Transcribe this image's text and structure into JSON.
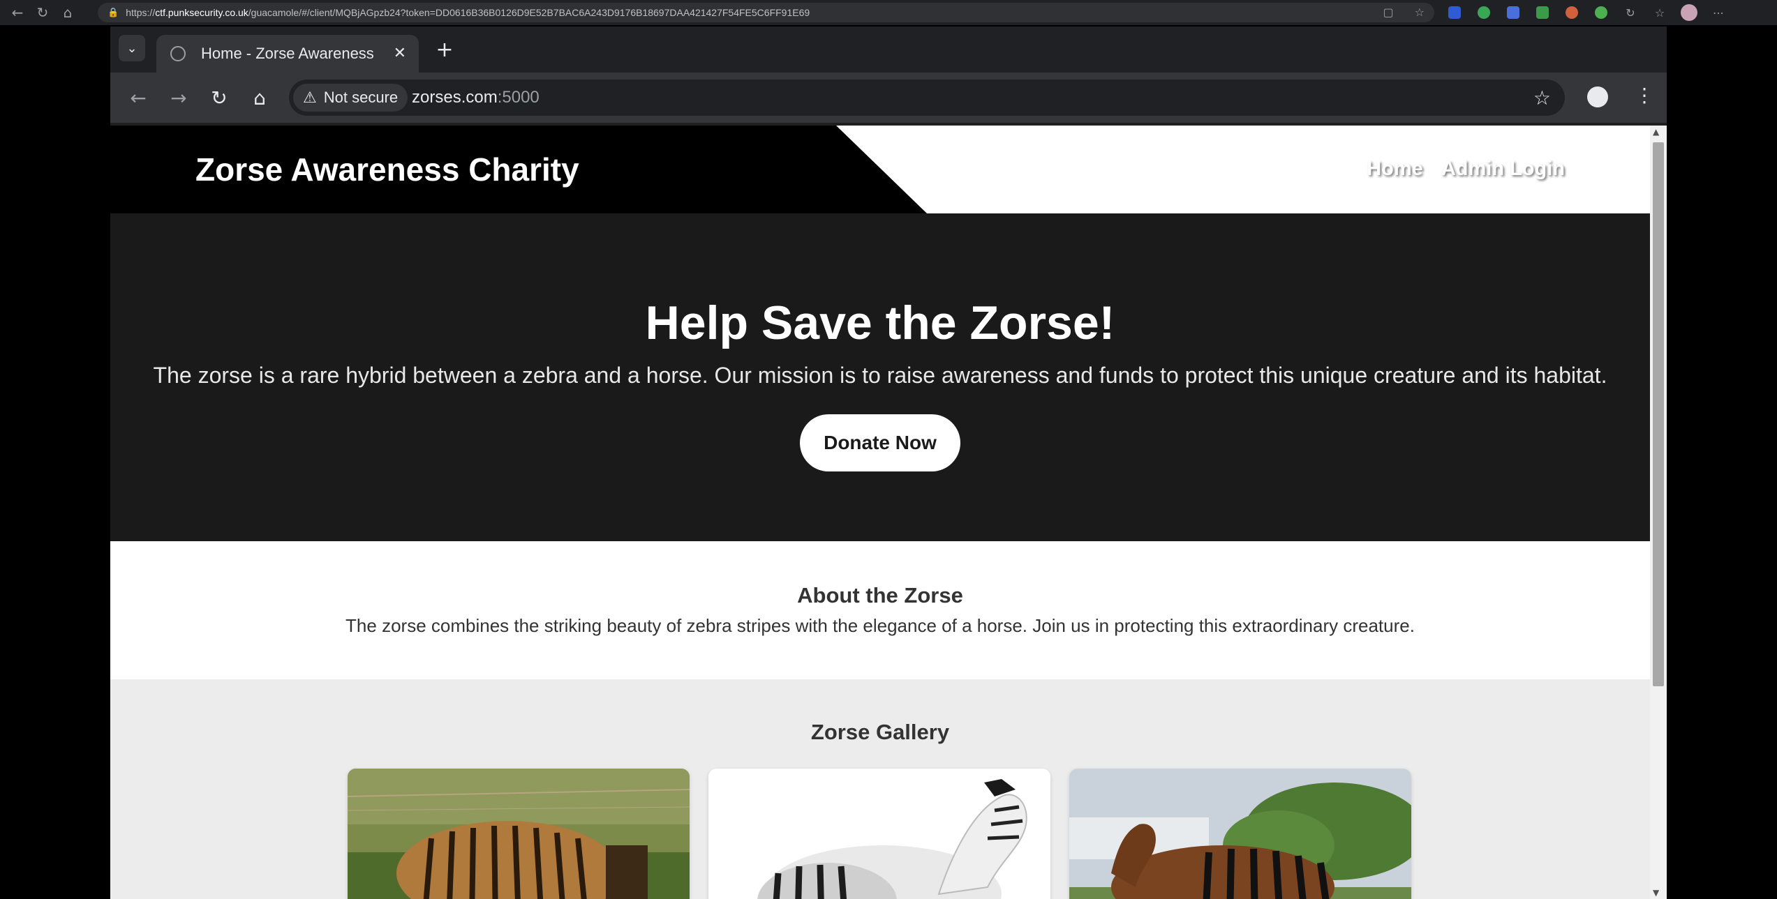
{
  "host_browser": {
    "url_prefix": "https://",
    "url_domain": "ctf.punksecurity.co.uk",
    "url_rest": "/guacamole/#/client/MQBjAGpzb24?token=DD0616B36B0126D9E52B7BAC6A243D9176B18697DAA421427F54FE5C6FF91E69"
  },
  "browser": {
    "tab_title": "Home - Zorse Awareness",
    "security_label": "Not secure",
    "url_host": "zorses.com",
    "url_port": ":5000"
  },
  "header": {
    "brand": "Zorse Awareness Charity",
    "nav": [
      "Home",
      "Admin Login"
    ]
  },
  "hero": {
    "title": "Help Save the Zorse!",
    "text": "The zorse is a rare hybrid between a zebra and a horse. Our mission is to raise awareness and funds to protect this unique creature and its habitat.",
    "button": "Donate Now"
  },
  "about": {
    "title": "About the Zorse",
    "text": "The zorse combines the striking beauty of zebra stripes with the elegance of a horse. Join us in protecting this extraordinary creature."
  },
  "gallery": {
    "title": "Zorse Gallery"
  },
  "colors": {
    "header_bg": "#000000",
    "hero_bg": "#1a1a1a",
    "gallery_bg": "#ececec",
    "button_bg": "#ffffff"
  }
}
